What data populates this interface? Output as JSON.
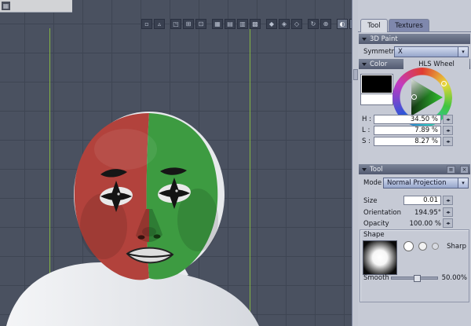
{
  "app": {
    "icon_glyph": "▦"
  },
  "toolbar": {
    "icons": [
      {
        "glyph": "▫"
      },
      {
        "glyph": "▵"
      },
      {
        "glyph": "◳"
      },
      {
        "glyph": "⊞"
      },
      {
        "glyph": "⊡"
      },
      {
        "glyph": "▦"
      },
      {
        "glyph": "▤"
      },
      {
        "glyph": "▥"
      },
      {
        "glyph": "▩"
      },
      {
        "glyph": "◆"
      },
      {
        "glyph": "◈"
      },
      {
        "glyph": "◇"
      },
      {
        "glyph": "↻"
      },
      {
        "glyph": "⊕"
      },
      {
        "glyph": "◐"
      },
      {
        "glyph": "◉"
      }
    ]
  },
  "panel": {
    "tabs": {
      "tool": "Tool",
      "textures": "Textures"
    },
    "paint": {
      "title": "3D Paint",
      "symmetry_label": "Symmetry",
      "symmetry_value": "X",
      "dropdown_arrow": "▾"
    },
    "color": {
      "title": "Color",
      "wheel_mode": "HLS Wheel",
      "h_label": "H :",
      "h_value": "34.50 %",
      "l_label": "L :",
      "l_value": "7.89 %",
      "s_label": "S :",
      "s_value": "8.27 %",
      "stepper_glyph": "◂▸"
    },
    "tool": {
      "title": "Tool",
      "options_glyph": "≡",
      "close_glyph": "×",
      "mode_label": "Mode",
      "mode_value": "Normal Projection",
      "size_label": "Size",
      "size_value": "0.01",
      "orientation_label": "Orientation",
      "orientation_value": "194.95°",
      "opacity_label": "Opacity",
      "opacity_value": "100.00 %",
      "shape": {
        "title": "Shape",
        "sharp_label": "Sharp",
        "smooth_label": "Smooth",
        "smooth_value": "50.00%"
      }
    }
  },
  "colors": {
    "paint_red": "#b2423c",
    "paint_green": "#3d9b41",
    "guide_green": "#8dc63f",
    "viewport_bg": "#4a5160"
  }
}
